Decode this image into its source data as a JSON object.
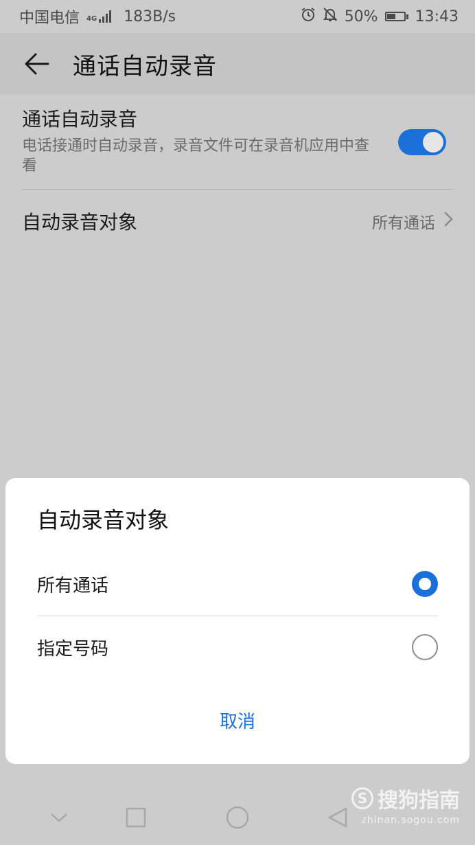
{
  "status_bar": {
    "carrier": "中国电信",
    "network_type": "4G",
    "speed": "183B/s",
    "battery": "50%",
    "battery_level": 0.5,
    "time": "13:43",
    "icons": [
      "signal-icon",
      "alarm-icon",
      "bell-off-icon",
      "battery-icon"
    ]
  },
  "header": {
    "back_icon": "arrow-left-icon",
    "title": "通话自动录音"
  },
  "settings": {
    "auto_record": {
      "title": "通话自动录音",
      "subtitle": "电话接通时自动录音，录音文件可在录音机应用中查看",
      "enabled": true
    },
    "record_target": {
      "title": "自动录音对象",
      "value": "所有通话",
      "chevron_icon": "chevron-right-icon"
    }
  },
  "dialog": {
    "title": "自动录音对象",
    "options": [
      {
        "label": "所有通话",
        "selected": true
      },
      {
        "label": "指定号码",
        "selected": false
      }
    ],
    "cancel_label": "取消"
  },
  "nav_bar": {
    "icons": [
      "chevron-down-icon",
      "square-icon",
      "circle-icon",
      "triangle-back-icon"
    ]
  },
  "watermark": {
    "brand": "搜狗指南",
    "url": "zhinan.sogou.com"
  },
  "colors": {
    "accent": "#1a6fd8",
    "background": "#cccccc",
    "dialog": "#ffffff"
  }
}
